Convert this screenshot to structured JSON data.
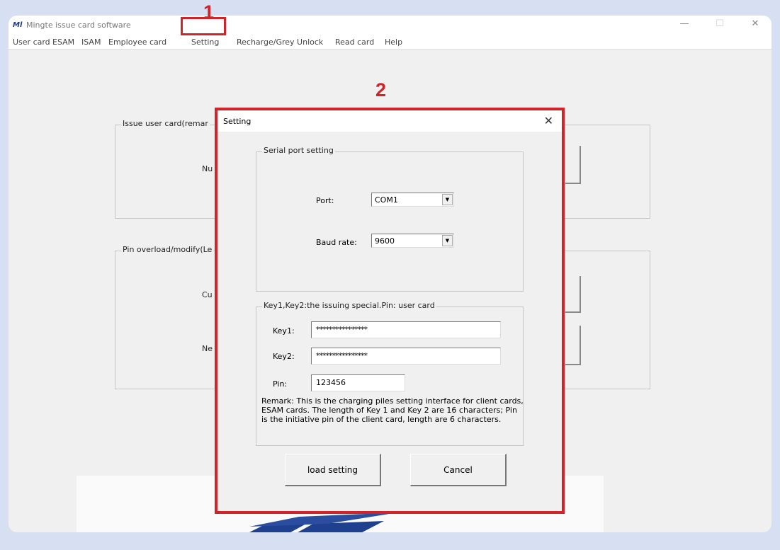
{
  "window": {
    "icon_text": "Ml",
    "title": "Mingte issue card software",
    "minimize": "—",
    "maximize": "☐",
    "close": "✕"
  },
  "menu": [
    "User card",
    "ESAM",
    "ISAM",
    "Employee card",
    "Setting",
    "Recharge/Grey Unlock",
    "Read card",
    "Help"
  ],
  "callouts": {
    "step1": "1",
    "step2": "2"
  },
  "background": {
    "issue_group_label": "Issue user card(remar",
    "issue_field_label": "Nu",
    "pin_group_label": "Pin overload/modify(Le",
    "pin_current_label": "Cu",
    "pin_new_label": "Ne"
  },
  "dialog": {
    "title": "Setting",
    "close": "✕",
    "serial": {
      "group_label": "Serial port setting",
      "port_label": "Port:",
      "port_value": "COM1",
      "baud_label": "Baud rate:",
      "baud_value": "9600"
    },
    "keys": {
      "group_label": "Key1,Key2:the issuing special.Pin: user card",
      "key1_label": "Key1:",
      "key1_value": "****************",
      "key2_label": "Key2:",
      "key2_value": "****************",
      "pin_label": "Pin:",
      "pin_value": "123456",
      "remark": "Remark: This is the charging piles setting interface for client cards, ESAM cards. The length of Key 1 and Key 2 are 16 characters; Pin is the initiative pin of the client card, length are 6 characters."
    },
    "load_button": "load setting",
    "cancel_button": "Cancel"
  },
  "colors": {
    "highlight": "#d0232a",
    "page_background": "#d7dff2",
    "window_background": "#f0f0f0"
  }
}
